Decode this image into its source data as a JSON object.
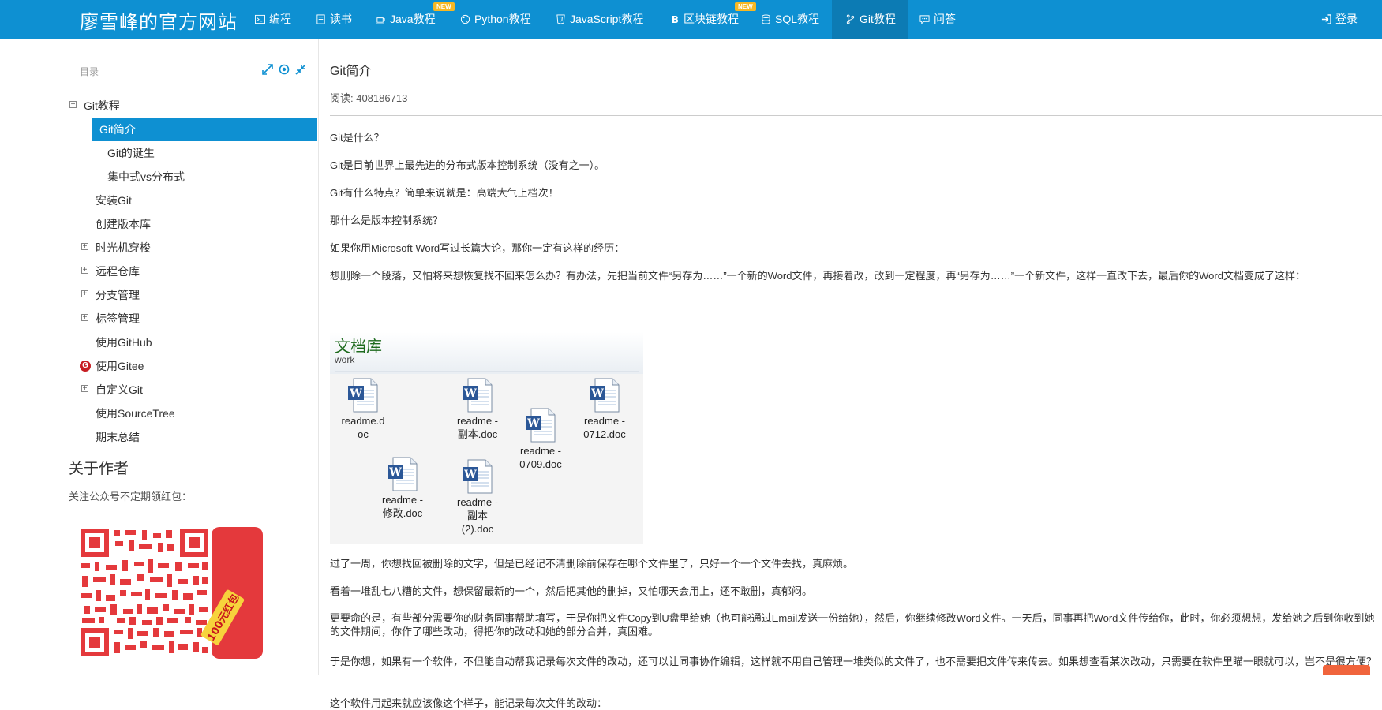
{
  "navbar": {
    "brand": "廖雪峰的官方网站",
    "items": [
      {
        "label": "编程",
        "icon": "terminal-icon"
      },
      {
        "label": "读书",
        "icon": "book-icon"
      },
      {
        "label": "Java教程",
        "icon": "coffee-icon",
        "badge": "NEW"
      },
      {
        "label": "Python教程",
        "icon": "python-icon"
      },
      {
        "label": "JavaScript教程",
        "icon": "html5-icon"
      },
      {
        "label": "区块链教程",
        "icon": "bitcoin-icon",
        "badge": "NEW"
      },
      {
        "label": "SQL教程",
        "icon": "database-icon"
      },
      {
        "label": "Git教程",
        "icon": "code-fork-icon",
        "active": true
      },
      {
        "label": "问答",
        "icon": "comments-icon"
      }
    ],
    "login": "登录"
  },
  "sidebar": {
    "toc_title": "目录",
    "items": [
      {
        "label": "Git教程",
        "expander": "minus"
      },
      {
        "label": "Git简介",
        "expander": "minus",
        "selected": true
      },
      {
        "label": "Git的诞生"
      },
      {
        "label": "集中式vs分布式"
      },
      {
        "label": "安装Git"
      },
      {
        "label": "创建版本库"
      },
      {
        "label": "时光机穿梭",
        "expander": "plus"
      },
      {
        "label": "远程仓库",
        "expander": "plus"
      },
      {
        "label": "分支管理",
        "expander": "plus"
      },
      {
        "label": "标签管理",
        "expander": "plus"
      },
      {
        "label": "使用GitHub"
      },
      {
        "label": "使用Gitee",
        "icon": "gitee-icon"
      },
      {
        "label": "自定义Git",
        "expander": "plus"
      },
      {
        "label": "使用SourceTree"
      },
      {
        "label": "期末总结"
      }
    ],
    "about_title": "关于作者",
    "about_sub": "关注公众号不定期领红包：",
    "qr_sticker": "100元红包"
  },
  "article": {
    "title": "Git简介",
    "read_count": "阅读: 408186713",
    "paragraphs": [
      "Git是什么？",
      "Git是目前世界上最先进的分布式版本控制系统（没有之一）。",
      "Git有什么特点？简单来说就是：高端大气上档次！",
      "那什么是版本控制系统？",
      "如果你用Microsoft Word写过长篇大论，那你一定有这样的经历：",
      "想删除一个段落，又怕将来想恢复找不回来怎么办？有办法，先把当前文件“另存为……”一个新的Word文件，再接着改，改到一定程度，再“另存为……”一个新文件，这样一直改下去，最后你的Word文档变成了这样："
    ],
    "paragraphs_after": [
      "过了一周，你想找回被删除的文字，但是已经记不清删除前保存在哪个文件里了，只好一个一个文件去找，真麻烦。",
      "看着一堆乱七八糟的文件，想保留最新的一个，然后把其他的删掉，又怕哪天会用上，还不敢删，真郁闷。",
      "更要命的是，有些部分需要你的财务同事帮助填写，于是你把文件Copy到U盘里给她（也可能通过Email发送一份给她），然后，你继续修改Word文件。一天后，同事再把Word文件传给你，此时，你必须想想，发给她之后到你收到她的文件期间，你作了哪些改动，得把你的改动和她的部分合并，真困难。",
      "于是你想，如果有一个软件，不但能自动帮我记录每次文件的改动，还可以让同事协作编辑，这样就不用自己管理一堆类似的文件了，也不需要把文件传来传去。如果想查看某次改动，只需要在软件里瞄一眼就可以，岂不是很方便？",
      "这个软件用起来就应该像这个样子，能记录每次文件的改动："
    ],
    "doclib": {
      "title": "文档库",
      "subtitle": "work",
      "files": [
        {
          "name": "readme.d\noc"
        },
        {
          "name": "readme -\n副本.doc"
        },
        {
          "name": "readme -\n0709.doc"
        },
        {
          "name": "readme -\n0712.doc"
        },
        {
          "name": "readme -\n修改.doc"
        },
        {
          "name": "readme -\n副本\n(2).doc"
        }
      ]
    }
  }
}
